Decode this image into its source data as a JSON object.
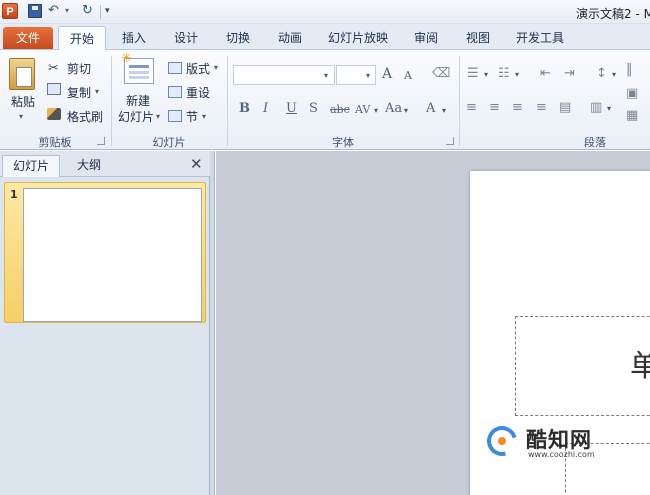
{
  "titlebar": {
    "app_icon": "P",
    "title": "演示文稿2 - M"
  },
  "tabs": {
    "file": "文件",
    "items": [
      "开始",
      "插入",
      "设计",
      "切换",
      "动画",
      "幻灯片放映",
      "审阅",
      "视图",
      "开发工具"
    ]
  },
  "ribbon": {
    "clipboard": {
      "paste": "粘贴",
      "cut": "剪切",
      "copy": "复制",
      "format_painter": "格式刷",
      "label": "剪贴板"
    },
    "slides": {
      "new_slide_1": "新建",
      "new_slide_2": "幻灯片",
      "layout": "版式",
      "reset": "重设",
      "section": "节",
      "label": "幻灯片"
    },
    "font": {
      "grow": "A",
      "shrink": "A",
      "bold": "B",
      "italic": "I",
      "underline": "U",
      "shadow": "S",
      "strike": "abc",
      "spacing": "AV",
      "case": "Aa",
      "color": "A",
      "label": "字体"
    },
    "paragraph": {
      "label": "段落"
    }
  },
  "pane": {
    "tab_slides": "幻灯片",
    "tab_outline": "大纲",
    "close": "✕",
    "slide_number": "1"
  },
  "slide": {
    "title_fragment": "单"
  },
  "watermark": {
    "name": "酷知网",
    "url": "www.coozhi.com"
  }
}
